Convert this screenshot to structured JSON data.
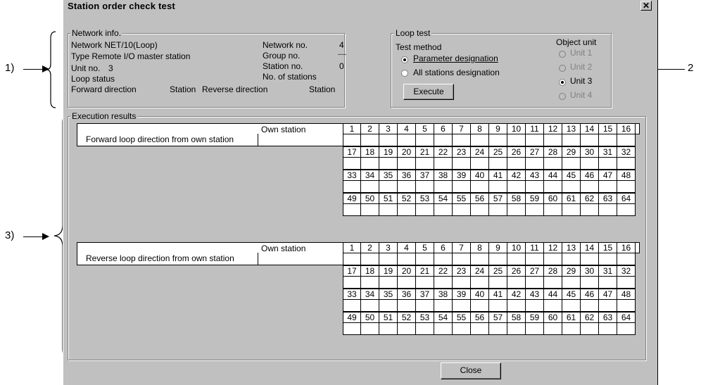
{
  "window": {
    "title": "Station order check test"
  },
  "annotations": {
    "a1": "1)",
    "a2": "2",
    "a3": "3)"
  },
  "network": {
    "group_label": "Network info.",
    "network_line": "Network  NET/10(Loop)",
    "type_line": "Type  Remote I/O master station",
    "unit_label": "Unit no.",
    "unit_value": "3",
    "loop_status": "Loop status",
    "forward_direction": "Forward direction",
    "station1": "Station",
    "reverse_direction": "Reverse direction",
    "station2": "Station",
    "network_no_label": "Network no.",
    "network_no_value": "4",
    "group_no_label": "Group no.",
    "group_no_value": "----",
    "station_no_label": "Station no.",
    "station_no_value": "0",
    "num_stations_label": "No. of stations"
  },
  "loop_test": {
    "group_label": "Loop test",
    "test_method_label": "Test method",
    "param_option": "Parameter designation",
    "all_option": "All stations designation",
    "execute_label": "Execute",
    "object_unit_label": "Object unit",
    "units": [
      "Unit 1",
      "Unit 2",
      "Unit 3",
      "Unit 4"
    ]
  },
  "results": {
    "group_label": "Execution results",
    "own_station": "Own station",
    "forward_label": "Forward loop direction from own station",
    "reverse_label": "Reverse loop direction from own station",
    "rows": [
      [
        "1",
        "2",
        "3",
        "4",
        "5",
        "6",
        "7",
        "8",
        "9",
        "10",
        "11",
        "12",
        "13",
        "14",
        "15",
        "16"
      ],
      [
        "17",
        "18",
        "19",
        "20",
        "21",
        "22",
        "23",
        "24",
        "25",
        "26",
        "27",
        "28",
        "29",
        "30",
        "31",
        "32"
      ],
      [
        "33",
        "34",
        "35",
        "36",
        "37",
        "38",
        "39",
        "40",
        "41",
        "42",
        "43",
        "44",
        "45",
        "46",
        "47",
        "48"
      ],
      [
        "49",
        "50",
        "51",
        "52",
        "53",
        "54",
        "55",
        "56",
        "57",
        "58",
        "59",
        "60",
        "61",
        "62",
        "63",
        "64"
      ]
    ]
  },
  "footer": {
    "close_label": "Close"
  }
}
